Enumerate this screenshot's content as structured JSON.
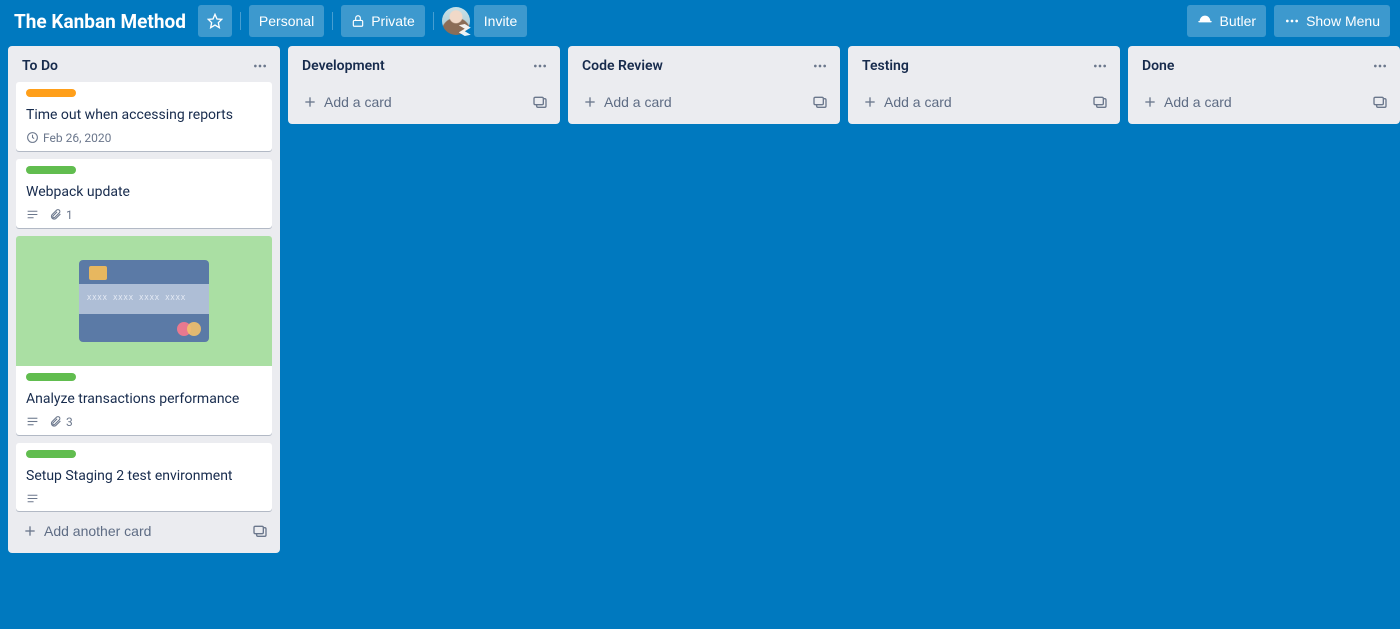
{
  "header": {
    "board_title": "The Kanban Method",
    "workspace_label": "Personal",
    "visibility_label": "Private",
    "invite_label": "Invite",
    "butler_label": "Butler",
    "show_menu_label": "Show Menu"
  },
  "add_card_label": "Add a card",
  "add_another_card_label": "Add another card",
  "lists": [
    {
      "title": "To Do"
    },
    {
      "title": "Development"
    },
    {
      "title": "Code Review"
    },
    {
      "title": "Testing"
    },
    {
      "title": "Done"
    }
  ],
  "todo_cards": [
    {
      "label_color": "orange",
      "title": "Time out when accessing reports",
      "due": "Feb 26, 2020",
      "has_cover": false
    },
    {
      "label_color": "green",
      "title": "Webpack update",
      "has_description": true,
      "attachments": "1",
      "has_cover": false
    },
    {
      "label_color": "green",
      "title": "Analyze transactions performance",
      "has_description": true,
      "attachments": "3",
      "has_cover": true
    },
    {
      "label_color": "green",
      "title": "Setup Staging 2 test environment",
      "has_description": true,
      "has_cover": false
    }
  ]
}
